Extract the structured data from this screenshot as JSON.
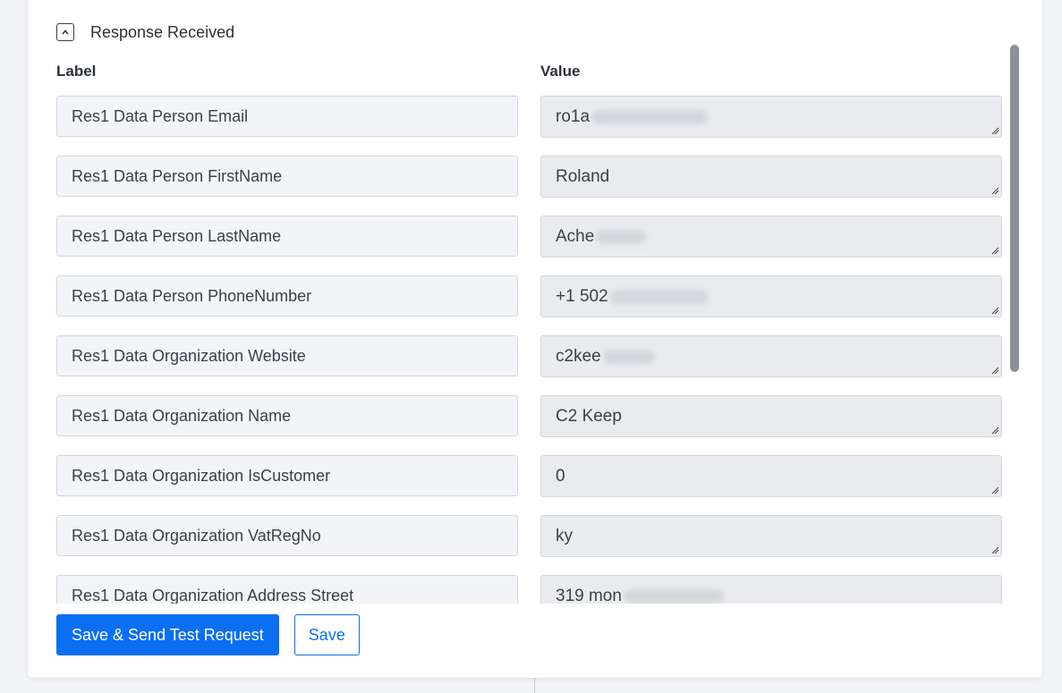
{
  "section": {
    "title": "Response Received",
    "columns": {
      "label": "Label",
      "value": "Value"
    }
  },
  "rows": [
    {
      "label": "Res1 Data Person Email",
      "value_visible": "ro1a"
    },
    {
      "label": "Res1 Data Person FirstName",
      "value_visible": "Roland"
    },
    {
      "label": "Res1 Data Person LastName",
      "value_visible": "Ache"
    },
    {
      "label": "Res1 Data Person PhoneNumber",
      "value_visible": "+1 502"
    },
    {
      "label": "Res1 Data Organization Website",
      "value_visible": "c2kee"
    },
    {
      "label": "Res1 Data Organization Name",
      "value_visible": "C2 Keep"
    },
    {
      "label": "Res1 Data Organization IsCustomer",
      "value_visible": "0"
    },
    {
      "label": "Res1 Data Organization VatRegNo",
      "value_visible": "ky"
    },
    {
      "label": "Res1 Data Organization Address Street",
      "value_visible": "319 mon"
    }
  ],
  "footer": {
    "send_test_label": "Save & Send Test Request",
    "save_label": "Save"
  },
  "colors": {
    "primary": "#0b6ff2",
    "label_bg": "#f2f4f7",
    "value_bg": "#e9ebee"
  },
  "icons": {
    "collapse": "chevron-up-icon",
    "resize": "resize-handle-icon"
  }
}
